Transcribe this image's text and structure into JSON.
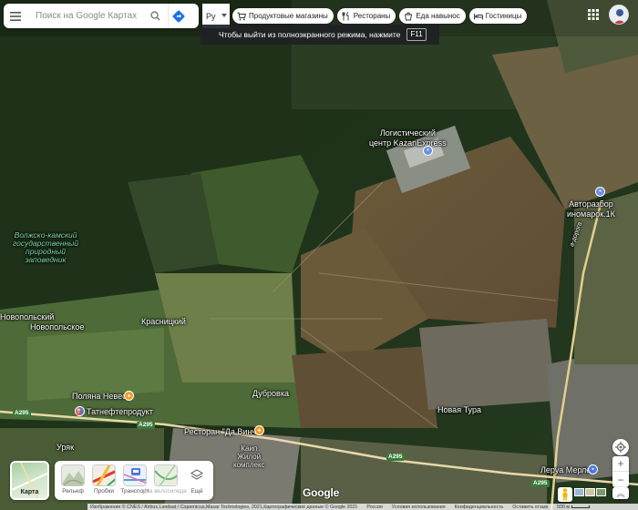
{
  "search": {
    "placeholder": "Поиск на Google Картах"
  },
  "language": {
    "value": "Ру"
  },
  "chips": [
    {
      "icon": "cart-icon",
      "label": "Продуктовые магазины"
    },
    {
      "icon": "fork-knife-icon",
      "label": "Рестораны"
    },
    {
      "icon": "takeout-icon",
      "label": "Еда навынос"
    },
    {
      "icon": "bed-icon",
      "label": "Гостиницы"
    }
  ],
  "fullscreen_notice": {
    "text": "Чтобы выйти из полноэкранного режима, нажмите",
    "key": "F11"
  },
  "map": {
    "labels": {
      "logistics": "Логистический\nцентр KazanExpress",
      "reserve": "Волжско-камский\nгосударственный\nприродный\nзаповедник",
      "autorazbor": "Авторазбор\nиномарок.1К",
      "novopolskoe_1": "Новопольский",
      "novopolskoe_2": "Новопольское",
      "krasnitsky": "Красницкий",
      "polyana": "Поляна Невест",
      "tatneft": "Татнефтепродукт",
      "restaurant": "Ресторан \"Да Винчи\"",
      "dubrovka": "Дубровка",
      "novaya_tura": "Новая Тура",
      "uryak": "Уряк",
      "leroy": "Леруа Мерлен",
      "kakhi": "Каип\nЖилой\nкомплекс",
      "doroga": "а-дорога"
    },
    "road_shields": {
      "a295_left": "A295",
      "a295_mid": "A295",
      "a295_right": "A295",
      "a295_bottom": "A295"
    }
  },
  "layers": {
    "main_label": "Карта",
    "items": [
      {
        "icon": "terrain-icon",
        "label": "Рельеф",
        "enabled": true
      },
      {
        "icon": "traffic-icon",
        "label": "Пробки",
        "enabled": true
      },
      {
        "icon": "transit-icon",
        "label": "Транспорт",
        "enabled": true
      },
      {
        "icon": "bicycle-icon",
        "label": "На велосипеде",
        "enabled": false
      },
      {
        "icon": "layers-icon",
        "label": "Ещё",
        "enabled": true
      }
    ]
  },
  "brand": {
    "logo": "Google"
  },
  "footer": {
    "imagery": "Изображения © CNES / Airbus,Landsat / Copernicus,Maxar Technologies, 2021,Картографические данные © Google 2021",
    "country": "Россия",
    "terms": "Условия использования",
    "privacy": "Конфиденциальность",
    "feedback": "Оставить отзыв",
    "scale": "500 м"
  },
  "colors": {
    "accent_blue": "#1a73e8",
    "pin_orange": "#f29a21",
    "reserve_green": "#7fd6a8"
  }
}
